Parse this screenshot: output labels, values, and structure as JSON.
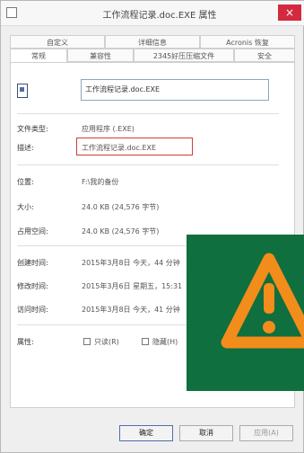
{
  "window": {
    "title": "工作流程记录.doc.EXE 属性",
    "close_label": "×"
  },
  "tabs": {
    "row1": [
      "自定义",
      "详细信息",
      "Acronis 恢复"
    ],
    "row2": [
      "常规",
      "兼容性",
      "2345好压压缩文件",
      "安全"
    ],
    "active": "常规"
  },
  "file": {
    "name": "工作流程记录.doc.EXE"
  },
  "properties": [
    {
      "label": "文件类型:",
      "value": "应用程序 (.EXE)"
    },
    {
      "label": "描述:",
      "value": "工作流程记录.doc.EXE"
    },
    {
      "label": "位置:",
      "value": "F:\\我的备份"
    },
    {
      "label": "大小:",
      "value": "24.0 KB (24,576 字节)"
    },
    {
      "label": "占用空间:",
      "value": "24.0 KB (24,576 字节)"
    },
    {
      "label": "创建时间:",
      "value": "2015年3月8日 今天，44 分钟"
    },
    {
      "label": "修改时间:",
      "value": "2015年3月6日 星期五，15:31"
    },
    {
      "label": "访问时间:",
      "value": "2015年3月8日 今天，41 分钟"
    }
  ],
  "attributes": {
    "label": "属性:",
    "readonly_label": "只读(R)",
    "hidden_label": "隐藏(H)"
  },
  "buttons": {
    "ok": "确定",
    "cancel": "取消",
    "apply": "应用(A)"
  },
  "overlay": {
    "background_color": "#0f6f3e",
    "warning_color": "#f28c1b",
    "icon": "warning-triangle-icon"
  }
}
